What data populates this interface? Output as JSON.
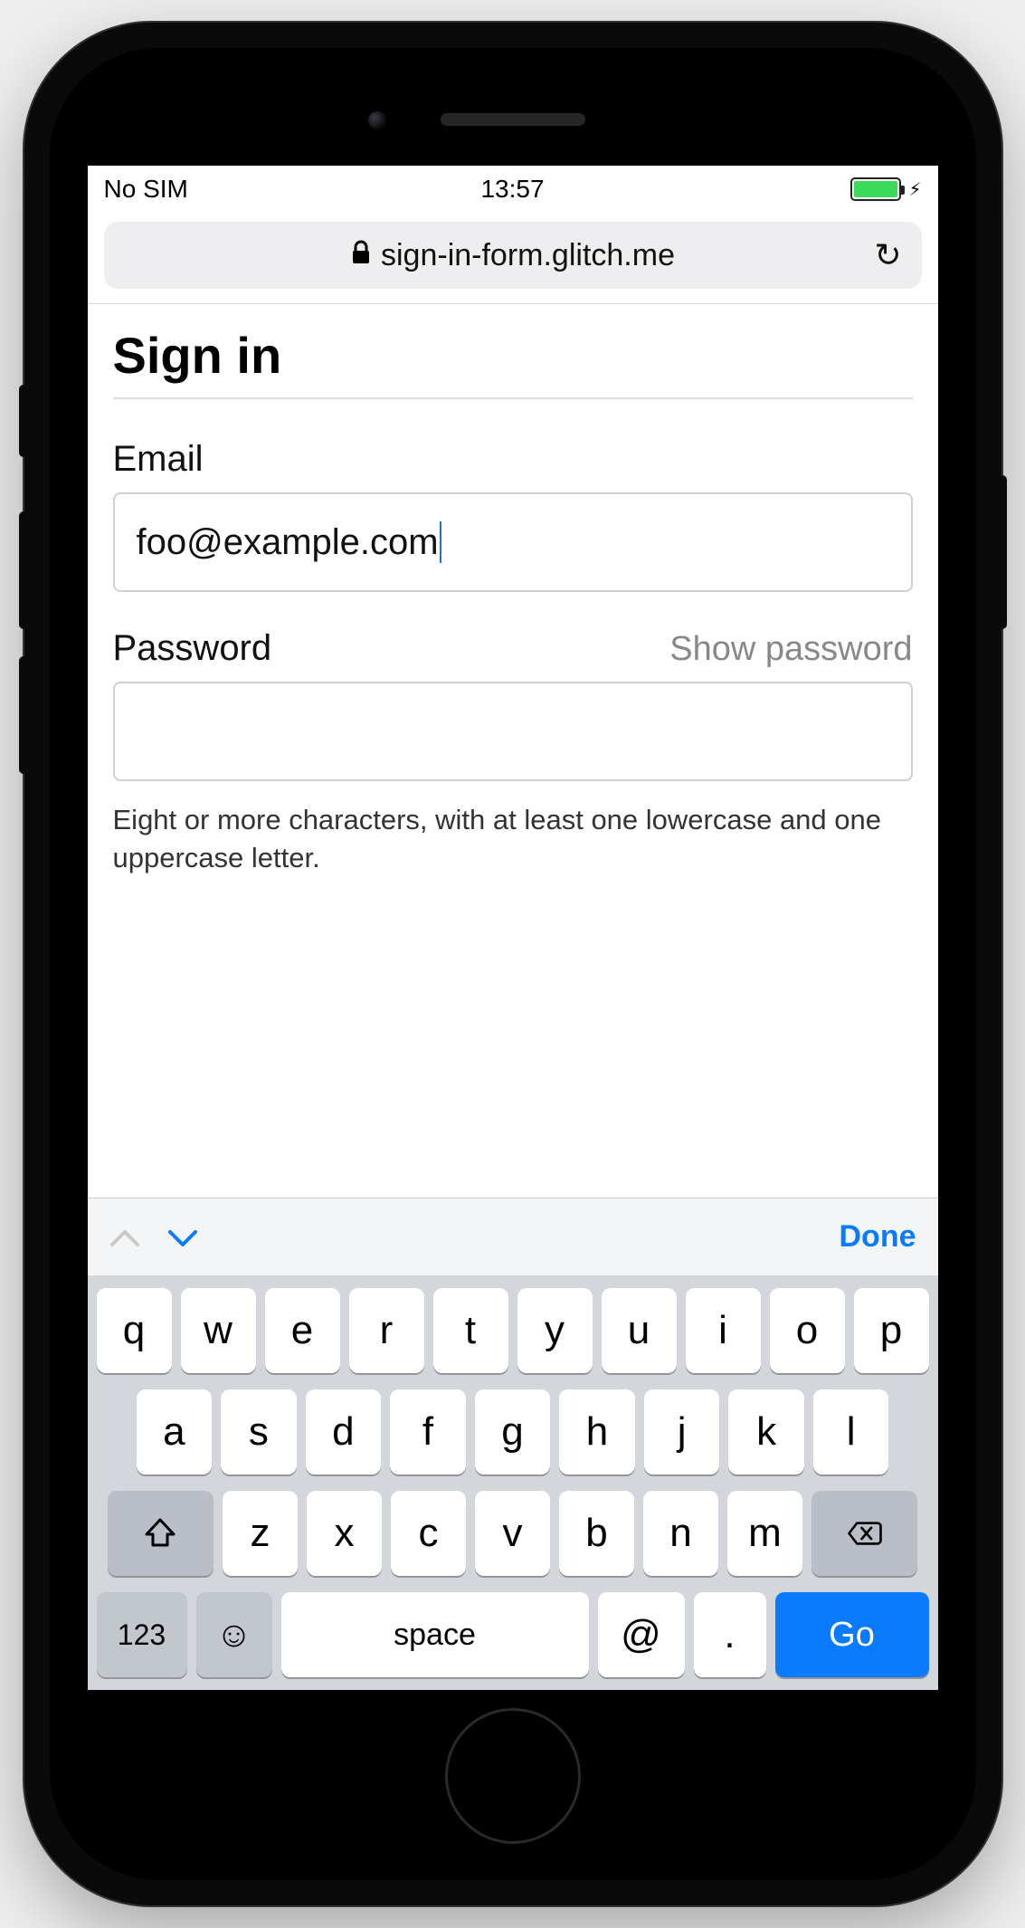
{
  "status": {
    "carrier": "No SIM",
    "time": "13:57"
  },
  "browser": {
    "url_display": "sign-in-form.glitch.me"
  },
  "page": {
    "heading": "Sign in",
    "email_label": "Email",
    "email_value": "foo@example.com",
    "password_label": "Password",
    "show_password": "Show password",
    "password_value": "",
    "password_hint": "Eight or more characters, with at least one lowercase and one uppercase letter."
  },
  "accessory": {
    "done": "Done"
  },
  "keyboard": {
    "row1": [
      "q",
      "w",
      "e",
      "r",
      "t",
      "y",
      "u",
      "i",
      "o",
      "p"
    ],
    "row2": [
      "a",
      "s",
      "d",
      "f",
      "g",
      "h",
      "j",
      "k",
      "l"
    ],
    "row3": [
      "z",
      "x",
      "c",
      "v",
      "b",
      "n",
      "m"
    ],
    "numbers_key": "123",
    "space_key": "space",
    "at_key": "@",
    "dot_key": ".",
    "go_key": "Go"
  }
}
